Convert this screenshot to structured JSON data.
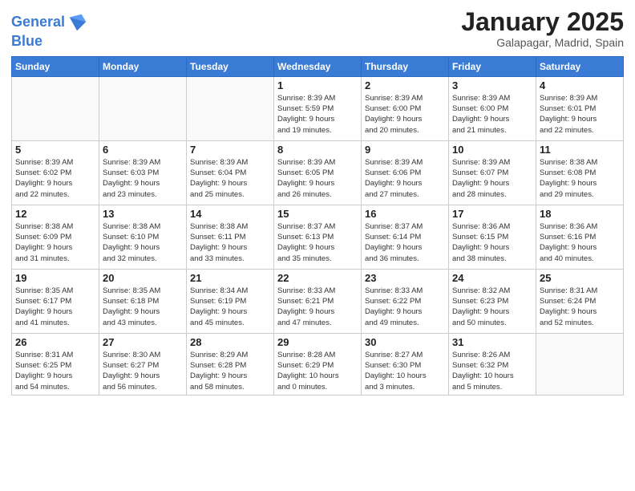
{
  "header": {
    "logo_line1": "General",
    "logo_line2": "Blue",
    "month_title": "January 2025",
    "location": "Galapagar, Madrid, Spain"
  },
  "weekdays": [
    "Sunday",
    "Monday",
    "Tuesday",
    "Wednesday",
    "Thursday",
    "Friday",
    "Saturday"
  ],
  "weeks": [
    [
      {
        "day": "",
        "info": ""
      },
      {
        "day": "",
        "info": ""
      },
      {
        "day": "",
        "info": ""
      },
      {
        "day": "1",
        "info": "Sunrise: 8:39 AM\nSunset: 5:59 PM\nDaylight: 9 hours\nand 19 minutes."
      },
      {
        "day": "2",
        "info": "Sunrise: 8:39 AM\nSunset: 6:00 PM\nDaylight: 9 hours\nand 20 minutes."
      },
      {
        "day": "3",
        "info": "Sunrise: 8:39 AM\nSunset: 6:00 PM\nDaylight: 9 hours\nand 21 minutes."
      },
      {
        "day": "4",
        "info": "Sunrise: 8:39 AM\nSunset: 6:01 PM\nDaylight: 9 hours\nand 22 minutes."
      }
    ],
    [
      {
        "day": "5",
        "info": "Sunrise: 8:39 AM\nSunset: 6:02 PM\nDaylight: 9 hours\nand 22 minutes."
      },
      {
        "day": "6",
        "info": "Sunrise: 8:39 AM\nSunset: 6:03 PM\nDaylight: 9 hours\nand 23 minutes."
      },
      {
        "day": "7",
        "info": "Sunrise: 8:39 AM\nSunset: 6:04 PM\nDaylight: 9 hours\nand 25 minutes."
      },
      {
        "day": "8",
        "info": "Sunrise: 8:39 AM\nSunset: 6:05 PM\nDaylight: 9 hours\nand 26 minutes."
      },
      {
        "day": "9",
        "info": "Sunrise: 8:39 AM\nSunset: 6:06 PM\nDaylight: 9 hours\nand 27 minutes."
      },
      {
        "day": "10",
        "info": "Sunrise: 8:39 AM\nSunset: 6:07 PM\nDaylight: 9 hours\nand 28 minutes."
      },
      {
        "day": "11",
        "info": "Sunrise: 8:38 AM\nSunset: 6:08 PM\nDaylight: 9 hours\nand 29 minutes."
      }
    ],
    [
      {
        "day": "12",
        "info": "Sunrise: 8:38 AM\nSunset: 6:09 PM\nDaylight: 9 hours\nand 31 minutes."
      },
      {
        "day": "13",
        "info": "Sunrise: 8:38 AM\nSunset: 6:10 PM\nDaylight: 9 hours\nand 32 minutes."
      },
      {
        "day": "14",
        "info": "Sunrise: 8:38 AM\nSunset: 6:11 PM\nDaylight: 9 hours\nand 33 minutes."
      },
      {
        "day": "15",
        "info": "Sunrise: 8:37 AM\nSunset: 6:13 PM\nDaylight: 9 hours\nand 35 minutes."
      },
      {
        "day": "16",
        "info": "Sunrise: 8:37 AM\nSunset: 6:14 PM\nDaylight: 9 hours\nand 36 minutes."
      },
      {
        "day": "17",
        "info": "Sunrise: 8:36 AM\nSunset: 6:15 PM\nDaylight: 9 hours\nand 38 minutes."
      },
      {
        "day": "18",
        "info": "Sunrise: 8:36 AM\nSunset: 6:16 PM\nDaylight: 9 hours\nand 40 minutes."
      }
    ],
    [
      {
        "day": "19",
        "info": "Sunrise: 8:35 AM\nSunset: 6:17 PM\nDaylight: 9 hours\nand 41 minutes."
      },
      {
        "day": "20",
        "info": "Sunrise: 8:35 AM\nSunset: 6:18 PM\nDaylight: 9 hours\nand 43 minutes."
      },
      {
        "day": "21",
        "info": "Sunrise: 8:34 AM\nSunset: 6:19 PM\nDaylight: 9 hours\nand 45 minutes."
      },
      {
        "day": "22",
        "info": "Sunrise: 8:33 AM\nSunset: 6:21 PM\nDaylight: 9 hours\nand 47 minutes."
      },
      {
        "day": "23",
        "info": "Sunrise: 8:33 AM\nSunset: 6:22 PM\nDaylight: 9 hours\nand 49 minutes."
      },
      {
        "day": "24",
        "info": "Sunrise: 8:32 AM\nSunset: 6:23 PM\nDaylight: 9 hours\nand 50 minutes."
      },
      {
        "day": "25",
        "info": "Sunrise: 8:31 AM\nSunset: 6:24 PM\nDaylight: 9 hours\nand 52 minutes."
      }
    ],
    [
      {
        "day": "26",
        "info": "Sunrise: 8:31 AM\nSunset: 6:25 PM\nDaylight: 9 hours\nand 54 minutes."
      },
      {
        "day": "27",
        "info": "Sunrise: 8:30 AM\nSunset: 6:27 PM\nDaylight: 9 hours\nand 56 minutes."
      },
      {
        "day": "28",
        "info": "Sunrise: 8:29 AM\nSunset: 6:28 PM\nDaylight: 9 hours\nand 58 minutes."
      },
      {
        "day": "29",
        "info": "Sunrise: 8:28 AM\nSunset: 6:29 PM\nDaylight: 10 hours\nand 0 minutes."
      },
      {
        "day": "30",
        "info": "Sunrise: 8:27 AM\nSunset: 6:30 PM\nDaylight: 10 hours\nand 3 minutes."
      },
      {
        "day": "31",
        "info": "Sunrise: 8:26 AM\nSunset: 6:32 PM\nDaylight: 10 hours\nand 5 minutes."
      },
      {
        "day": "",
        "info": ""
      }
    ]
  ]
}
